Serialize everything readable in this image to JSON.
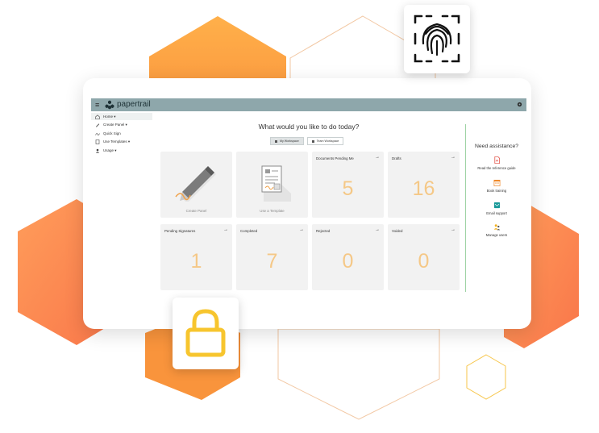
{
  "app": {
    "name": "papertrail",
    "brand_color": "#8ea7ab",
    "accent_color": "#f5c887"
  },
  "sidebar": {
    "items": [
      {
        "label": "Home ▾",
        "icon": "home-icon",
        "active": true
      },
      {
        "label": "Create Panel ▾",
        "icon": "pen-icon"
      },
      {
        "label": "Quick Sign",
        "icon": "sign-icon"
      },
      {
        "label": "Use Templates ▾",
        "icon": "template-icon"
      },
      {
        "label": "Usage ▾",
        "icon": "user-icon"
      }
    ]
  },
  "main": {
    "greeting": "What would you like to do today?",
    "workspaces": [
      {
        "label": "My Workspace",
        "active": true
      },
      {
        "label": "Team Workspace",
        "active": false
      }
    ],
    "tiles": [
      {
        "type": "action",
        "caption": "Create Panel",
        "icon": "pen-icon"
      },
      {
        "type": "action",
        "caption": "Use a Template",
        "icon": "document-icon"
      },
      {
        "type": "count",
        "label": "Documents Pending Me",
        "value": "5"
      },
      {
        "type": "count",
        "label": "Drafts",
        "value": "16"
      },
      {
        "type": "count",
        "label": "Pending Signatures",
        "value": "1"
      },
      {
        "type": "count",
        "label": "Completed",
        "value": "7"
      },
      {
        "type": "count",
        "label": "Rejected",
        "value": "0"
      },
      {
        "type": "count",
        "label": "Voided",
        "value": "0"
      }
    ]
  },
  "assistance": {
    "title": "Need assistance?",
    "items": [
      {
        "label": "Read the reference guide",
        "icon": "pdf-icon"
      },
      {
        "label": "Book training",
        "icon": "calendar-icon"
      },
      {
        "label": "Email support",
        "icon": "email-icon"
      },
      {
        "label": "Manage users",
        "icon": "users-icon"
      }
    ]
  },
  "badges": [
    {
      "icon": "fingerprint-icon"
    },
    {
      "icon": "lock-icon",
      "color": "#f7c52e"
    }
  ]
}
